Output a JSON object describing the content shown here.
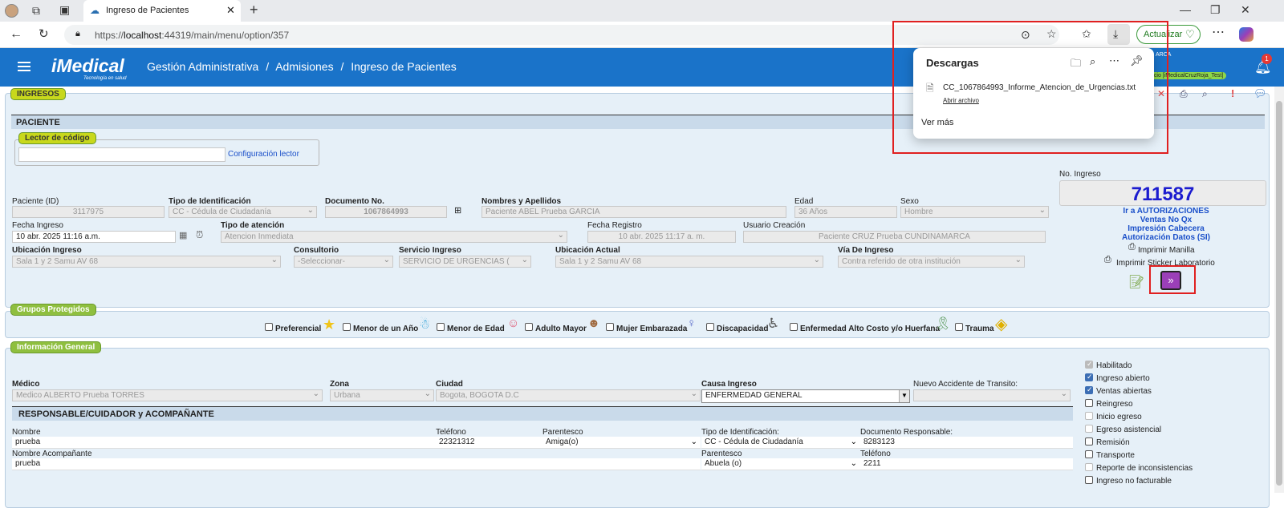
{
  "browser": {
    "tab_title": "Ingreso de Pacientes",
    "url_prefix": "https://",
    "url_host": "localhost",
    "url_rest": ":44319/main/menu/option/357",
    "update_button": "Actualizar"
  },
  "downloads": {
    "title": "Descargas",
    "file_name": "CC_1067864993_Informe_Atencion_de_Urgencias.txt",
    "open_file": "Abrir archivo",
    "see_more": "Ver más"
  },
  "app": {
    "logo": "iMedical",
    "logo_tagline": "Tecnología en salud",
    "breadcrumb": [
      "Gestión Administrativa",
      "/",
      "Admisiones",
      "/",
      "Ingreso de Pacientes"
    ],
    "user_line": "ARCA",
    "env_badge": "ocio [iMedicalCruzRoja_Test]",
    "notif_count": "1"
  },
  "ingresos": {
    "legend": "INGRESOS",
    "patient_header": "PACIENTE",
    "reader_legend": "Lector de código",
    "reader_value": "",
    "reader_config": "Configuración lector",
    "no_ingreso_label": "No. Ingreso",
    "no_ingreso": "711587",
    "links": [
      "Ir a AUTORIZACIONES",
      "Ventas No Qx",
      "Impresión Cabecera",
      "Autorización Datos (SI)"
    ],
    "print_bracelet": "Imprimir Manilla",
    "print_sticker": "Imprimir Sticker Laboratorio",
    "paciente_id_label": "Paciente (ID)",
    "paciente_id": "3117975",
    "tipo_id_label": "Tipo de Identificación",
    "tipo_id": "CC - Cédula de Ciudadanía",
    "documento_label": "Documento No.",
    "documento": "1067864993",
    "nombres_label": "Nombres y Apellidos",
    "nombres": "Paciente ABEL Prueba GARCIA",
    "edad_label": "Edad",
    "edad": "36  Años",
    "sexo_label": "Sexo",
    "sexo": "Hombre",
    "fecha_ingreso_label": "Fecha Ingreso",
    "fecha_ingreso": "10 abr. 2025 11:16 a.m.",
    "tipo_atencion_label": "Tipo de atención",
    "tipo_atencion": "Atencion Inmediata",
    "fecha_registro_label": "Fecha Registro",
    "fecha_registro": "10 abr. 2025 11:17 a. m.",
    "usuario_label": "Usuario Creación",
    "usuario": "Paciente CRUZ Prueba CUNDINAMARCA",
    "ubic_ingreso_label": "Ubicación Ingreso",
    "ubic_ingreso": "Sala 1 y 2 Samu AV 68",
    "consultorio_label": "Consultorio",
    "consultorio": "-Seleccionar-",
    "servicio_label": "Servicio Ingreso",
    "servicio": "SERVICIO DE URGENCIAS (",
    "ubic_actual_label": "Ubicación Actual",
    "ubic_actual": "Sala 1 y 2 Samu AV 68",
    "via_label": "Vía De Ingreso",
    "via": "Contra referido de otra institución"
  },
  "grupos": {
    "legend": "Grupos Protegidos",
    "items": [
      "Preferencial",
      "Menor de un Año",
      "Menor de Edad",
      "Adulto Mayor",
      "Mujer Embarazada",
      "Discapacidad",
      "Enfermedad Alto Costo y/o Huerfana",
      "Trauma"
    ]
  },
  "info": {
    "legend": "Información General",
    "medico_label": "Médico",
    "medico": "Medico ALBERTO Prueba TORRES",
    "zona_label": "Zona",
    "zona": "Urbana",
    "ciudad_label": "Ciudad",
    "ciudad": "Bogota, BOGOTA D.C",
    "causa_label": "Causa Ingreso",
    "causa": "ENFERMEDAD GENERAL",
    "accidente_label": "Nuevo Accidente de Transito:",
    "accidente": "",
    "resp_header": "RESPONSABLE/CUIDADOR y ACOMPAÑANTE",
    "nombre_label": "Nombre",
    "nombre": "prueba",
    "telefono_label": "Teléfono",
    "telefono": "22321312",
    "parentesco_label": "Parentesco",
    "parentesco": "Amiga(o)",
    "tipo_id_label": "Tipo de Identificación:",
    "tipo_id": "CC - Cédula de Ciudadanía",
    "doc_resp_label": "Documento Responsable:",
    "doc_resp": "8283123",
    "acomp_label": "Nombre Acompañante",
    "acomp": "prueba",
    "acomp_parentesco_label": "Parentesco",
    "acomp_parentesco": "Abuela (o)",
    "acomp_telefono_label": "Teléfono",
    "acomp_telefono": "2211"
  },
  "flags": [
    {
      "label": "Habilitado",
      "checked": true,
      "disabled": true
    },
    {
      "label": "Ingreso abierto",
      "checked": true,
      "disabled": false
    },
    {
      "label": "Ventas abiertas",
      "checked": true,
      "disabled": false
    },
    {
      "label": "Reingreso",
      "checked": false,
      "disabled": false
    },
    {
      "label": "Inicio egreso",
      "checked": false,
      "disabled": true
    },
    {
      "label": "Egreso asistencial",
      "checked": false,
      "disabled": true
    },
    {
      "label": "Remisión",
      "checked": false,
      "disabled": false
    },
    {
      "label": "Transporte",
      "checked": false,
      "disabled": false
    },
    {
      "label": "Reporte de inconsistencias",
      "checked": false,
      "disabled": true
    },
    {
      "label": "Ingreso no facturable",
      "checked": false,
      "disabled": false
    }
  ],
  "colors": {
    "appbar": "#1a73c9",
    "legend_green": "#8fbf3f",
    "ingreso_number": "#1c1ccf",
    "highlight": "#e02020",
    "accent_purple": "#9b3fb8"
  }
}
